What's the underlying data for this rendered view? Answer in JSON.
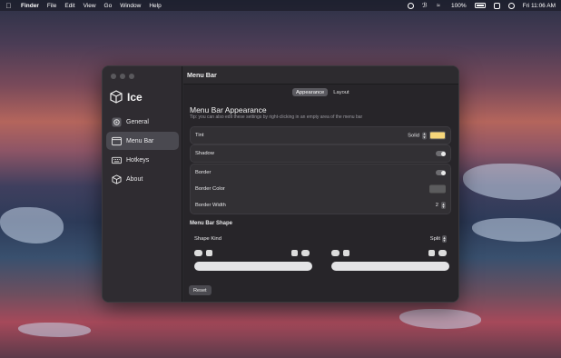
{
  "menubar": {
    "app_name": "Finder",
    "items": [
      "File",
      "Edit",
      "View",
      "Go",
      "Window",
      "Help"
    ],
    "battery": "100%",
    "clock": "Fri 11:06 AM"
  },
  "sidebar": {
    "brand": "Ice",
    "items": [
      {
        "label": "General",
        "icon": "gear-icon"
      },
      {
        "label": "Menu Bar",
        "icon": "menubar-icon",
        "active": true
      },
      {
        "label": "Hotkeys",
        "icon": "keyboard-icon"
      },
      {
        "label": "About",
        "icon": "cube-icon"
      }
    ]
  },
  "main": {
    "title": "Menu Bar",
    "tabs": [
      {
        "label": "Appearance",
        "active": true
      },
      {
        "label": "Layout",
        "active": false
      }
    ],
    "section_title": "Menu Bar Appearance",
    "tip": "Tip: you can also edit these settings by right-clicking in an empty area of the menu bar",
    "tint": {
      "label": "Tint",
      "value": "Solid",
      "color": "#f7d77a"
    },
    "shadow": {
      "label": "Shadow"
    },
    "border": {
      "label": "Border"
    },
    "border_color": {
      "label": "Border Color",
      "color": "#5c5c5e"
    },
    "border_width": {
      "label": "Border Width",
      "value": "2"
    },
    "shape_header": "Menu Bar Shape",
    "shape_kind": {
      "label": "Shape Kind",
      "value": "Split"
    },
    "reset_label": "Reset"
  }
}
